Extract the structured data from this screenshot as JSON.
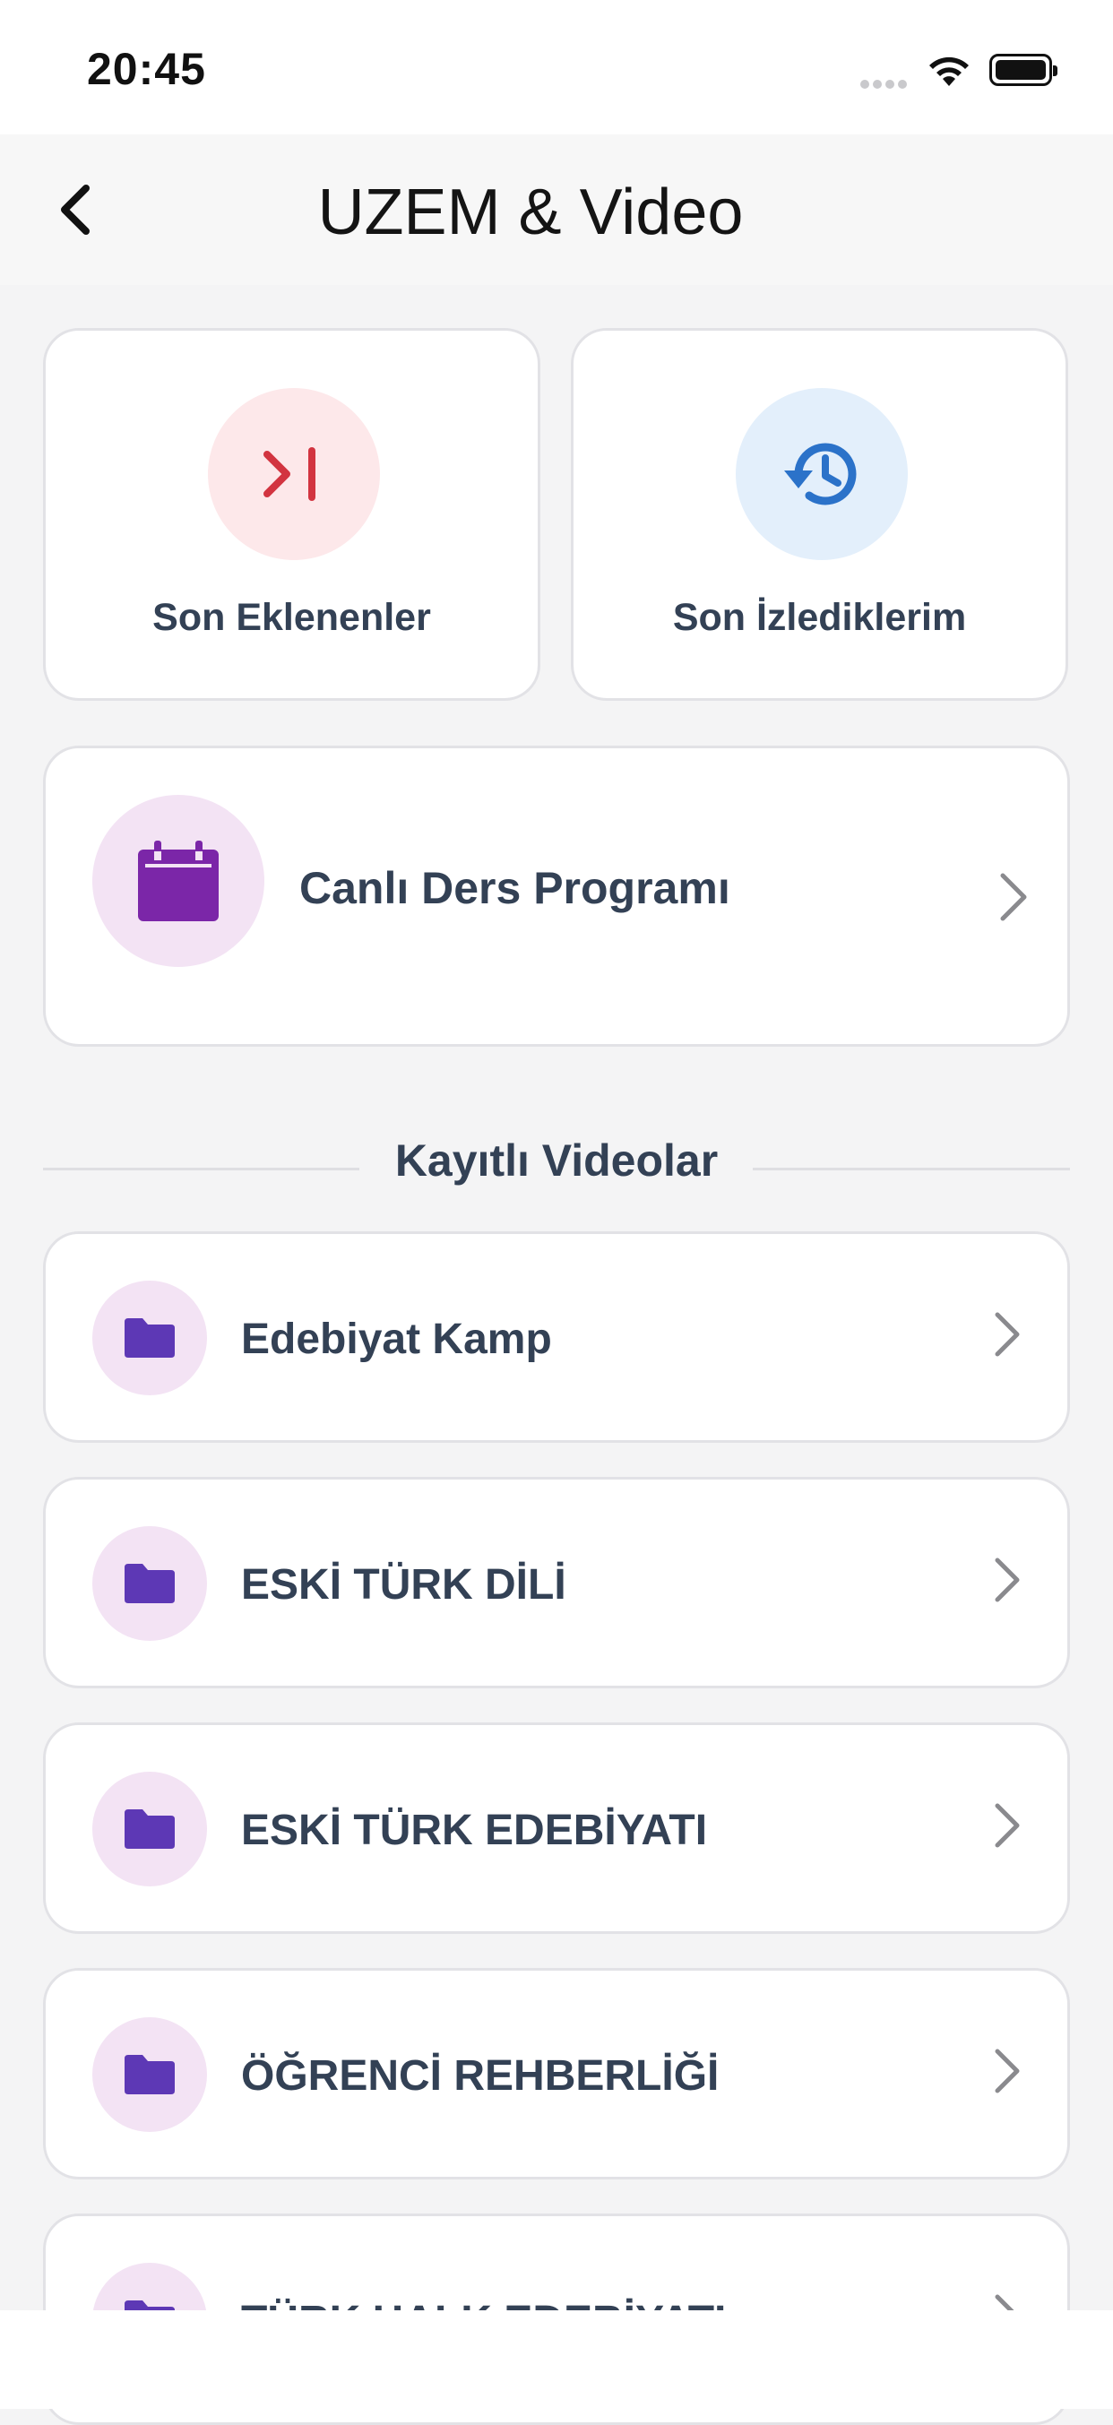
{
  "status_bar": {
    "time": "20:45"
  },
  "nav": {
    "title": "UZEM & Video"
  },
  "tiles": [
    {
      "label": "Son Eklenenler",
      "icon": "skip-forward-icon",
      "bg": "#fde8ea",
      "color": "#d23440"
    },
    {
      "label": "Son İzlediklerim",
      "icon": "history-icon",
      "bg": "#e3effb",
      "color": "#2b72c9"
    }
  ],
  "live_schedule": {
    "label": "Canlı Ders Programı",
    "icon": "calendar-icon",
    "color": "#7b26a8"
  },
  "section": {
    "title": "Kayıtlı Videolar"
  },
  "folders": [
    {
      "label": "Edebiyat Kamp"
    },
    {
      "label": "ESKİ TÜRK DİLİ"
    },
    {
      "label": "ESKİ TÜRK EDEBİYATI"
    },
    {
      "label": "ÖĞRENCİ REHBERLİĞİ"
    },
    {
      "label": "TÜRK HALK EDEBİYATI"
    }
  ],
  "colors": {
    "folder_icon": "#5d38b5",
    "folder_circle": "#f3e3f4",
    "chevron": "#8a8a8e"
  }
}
